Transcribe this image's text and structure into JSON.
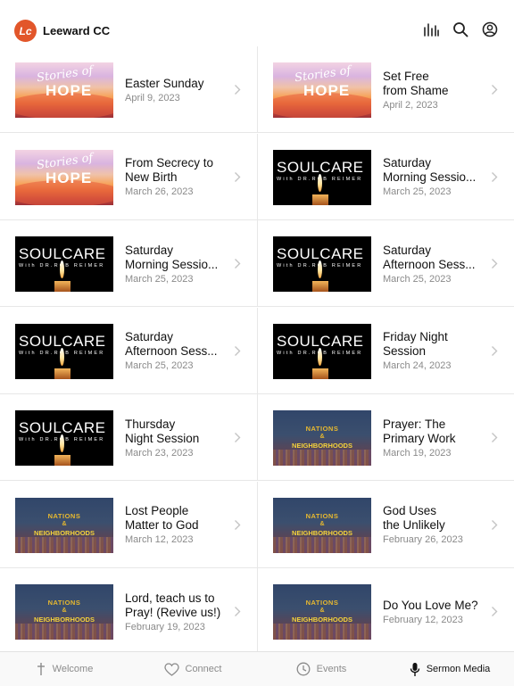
{
  "app": {
    "name": "Leeward CC",
    "logo_text": "Lc"
  },
  "header_icons": [
    "equalizer-icon",
    "search-icon",
    "profile-icon"
  ],
  "sermons": [
    {
      "title": "Easter Sunday",
      "date": "April 9, 2023",
      "series": "hope"
    },
    {
      "title": "Set Free\nfrom Shame",
      "date": "April 2, 2023",
      "series": "hope"
    },
    {
      "title": "From Secrecy to\nNew Birth",
      "date": "March 26, 2023",
      "series": "hope"
    },
    {
      "title": "Saturday\nMorning Sessio...",
      "date": "March 25, 2023",
      "series": "soul"
    },
    {
      "title": "Saturday\nMorning Sessio...",
      "date": "March 25, 2023",
      "series": "soul"
    },
    {
      "title": "Saturday\nAfternoon Sess...",
      "date": "March 25, 2023",
      "series": "soul"
    },
    {
      "title": "Saturday\nAfternoon Sess...",
      "date": "March 25, 2023",
      "series": "soul"
    },
    {
      "title": "Friday Night\nSession",
      "date": "March 24, 2023",
      "series": "soul"
    },
    {
      "title": "Thursday\nNight Session",
      "date": "March 23, 2023",
      "series": "soul"
    },
    {
      "title": "Prayer: The\nPrimary Work",
      "date": "March 19, 2023",
      "series": "nations"
    },
    {
      "title": "Lost People\nMatter to God",
      "date": "March 12, 2023",
      "series": "nations"
    },
    {
      "title": "God Uses\nthe Unlikely",
      "date": "February 26, 2023",
      "series": "nations"
    },
    {
      "title": "Lord, teach us to\nPray! (Revive us!)",
      "date": "February 19, 2023",
      "series": "nations"
    },
    {
      "title": "Do You Love Me?",
      "date": "February 12, 2023",
      "series": "nations"
    }
  ],
  "series_art": {
    "hope": {
      "line1": "Stories of",
      "line2": "HOPE"
    },
    "soul": {
      "line1": "SOULCARE",
      "line2": "With DR.ROB REIMER"
    },
    "nations": {
      "line1": "NATIONS",
      "line2": "&",
      "line3": "NEIGHBORHOODS"
    }
  },
  "tabs": [
    {
      "label": "Welcome",
      "icon": "cross-icon",
      "active": false
    },
    {
      "label": "Connect",
      "icon": "heart-icon",
      "active": false
    },
    {
      "label": "Events",
      "icon": "clock-icon",
      "active": false
    },
    {
      "label": "Sermon Media",
      "icon": "microphone-icon",
      "active": true
    }
  ],
  "colors": {
    "accent": "#e2562a",
    "divider": "#e7e7e7",
    "muted": "#8a8a8a"
  }
}
